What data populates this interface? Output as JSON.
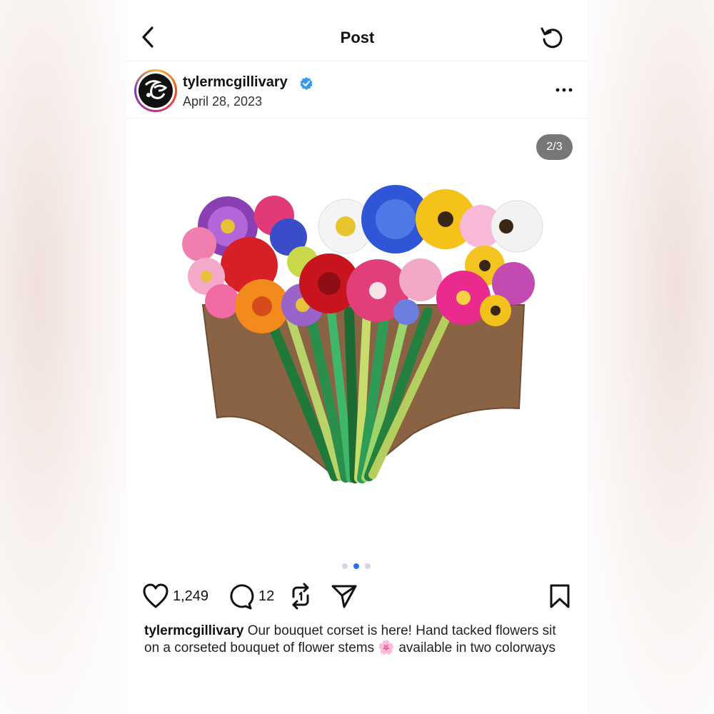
{
  "header": {
    "title": "Post"
  },
  "post": {
    "username": "tylermcgillivary",
    "date": "April 28, 2023",
    "image_counter": "2/3",
    "carousel_dots": 3,
    "carousel_active_index": 1,
    "likes": "1,249",
    "comments": "12",
    "caption_user": "tylermcgillivary",
    "caption_text": "Our bouquet corset is here! Hand tacked flowers sit on a corseted bouquet of flower stems 🌸 available in two colorways"
  },
  "icons": {
    "back": "chevron-left-icon",
    "refresh": "refresh-icon",
    "more": "more-horizontal-icon",
    "verified": "verified-badge-icon",
    "like": "heart-icon",
    "comment": "comment-icon",
    "repost": "repost-icon",
    "share": "send-icon",
    "save": "bookmark-icon"
  },
  "colors": {
    "verified": "#3897f0",
    "carousel_active": "#2f6fea",
    "counter_bg": "#777777"
  }
}
